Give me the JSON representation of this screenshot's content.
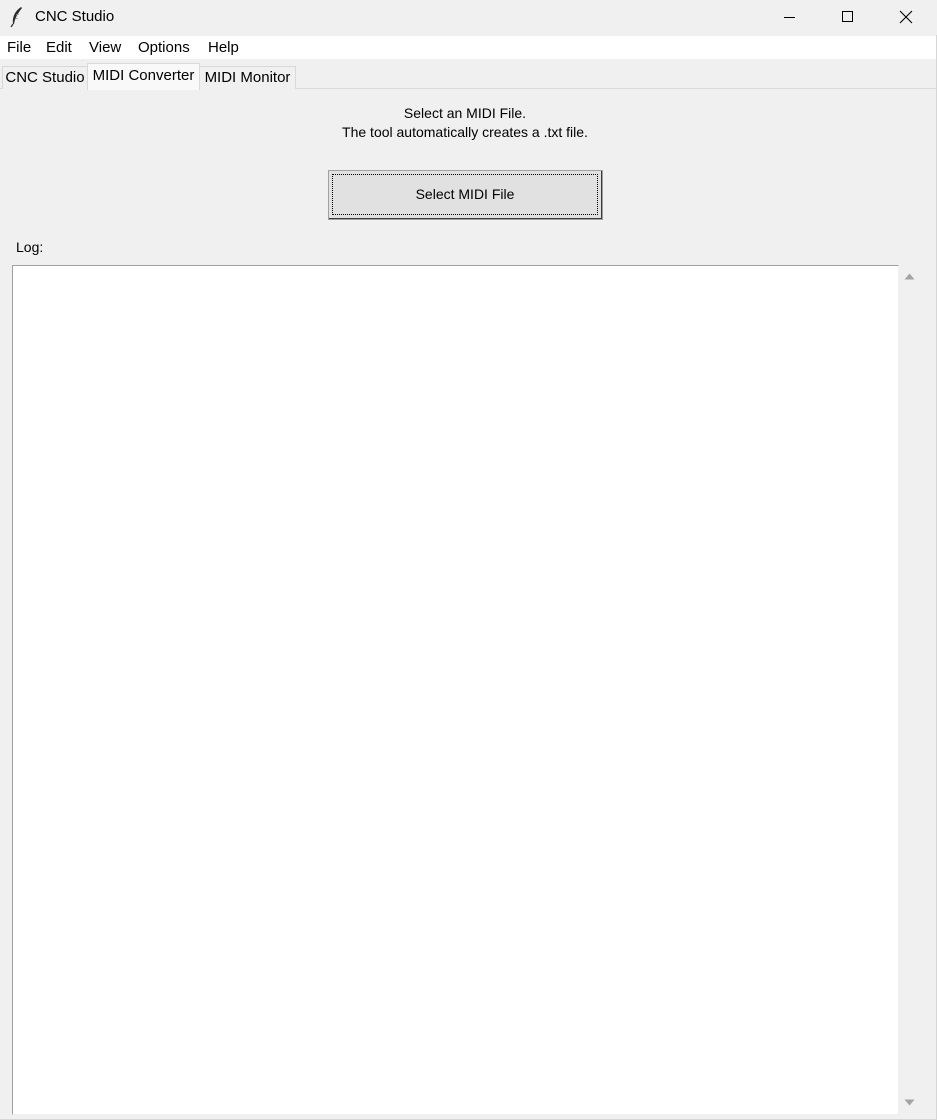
{
  "window": {
    "title": "CNC Studio",
    "icon": "feather-icon",
    "controls": [
      "minimize-icon",
      "maximize-icon",
      "close-icon"
    ]
  },
  "menubar": {
    "items": [
      "File",
      "Edit",
      "View",
      "Options",
      "Help"
    ]
  },
  "tabs": [
    {
      "label": "CNC Studio",
      "active": false
    },
    {
      "label": "MIDI Converter",
      "active": true
    },
    {
      "label": "MIDI Monitor",
      "active": false
    }
  ],
  "converter": {
    "instruction_line1": "Select an MIDI File.",
    "instruction_line2": "The tool automatically creates a .txt file.",
    "select_button_label": "Select MIDI File",
    "log_label": "Log:",
    "log_text": ""
  }
}
